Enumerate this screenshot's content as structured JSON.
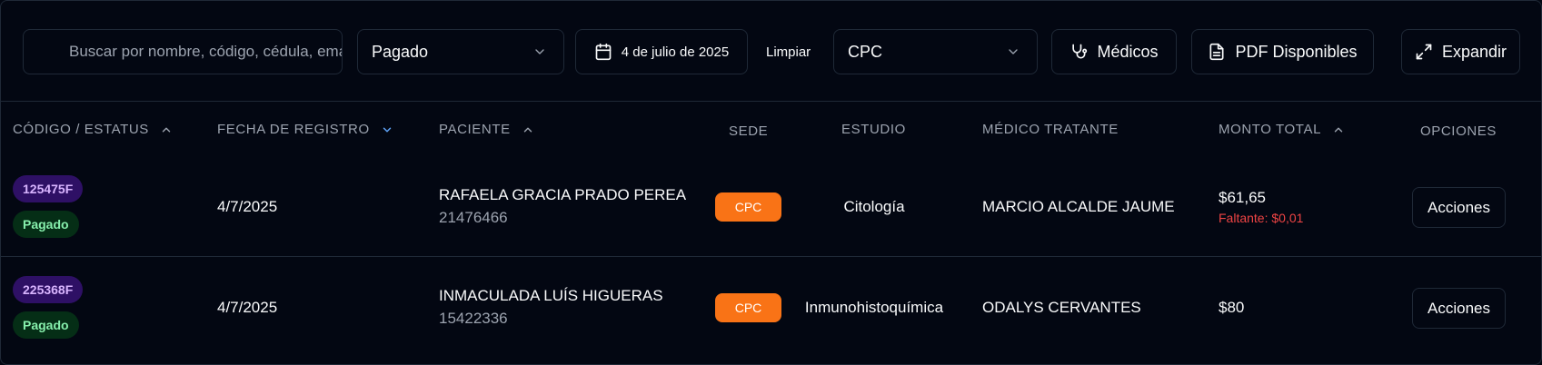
{
  "toolbar": {
    "search_placeholder": "Buscar por nombre, código, cédula, email...",
    "status_filter": "Pagado",
    "date_filter": "4 de julio de 2025",
    "clear_label": "Limpiar",
    "branch_filter": "CPC",
    "doctors_label": "Médicos",
    "pdf_label": "PDF Disponibles",
    "expand_label": "Expandir"
  },
  "table": {
    "headers": {
      "code_status": "CÓDIGO / ESTATUS",
      "registration_date": "FECHA DE REGISTRO",
      "patient": "PACIENTE",
      "branch": "SEDE",
      "study": "ESTUDIO",
      "doctor": "MÉDICO TRATANTE",
      "total": "MONTO TOTAL",
      "options": "OPCIONES"
    },
    "rows": [
      {
        "code": "125475F",
        "status": "Pagado",
        "date": "4/7/2025",
        "patient_name": "RAFAELA GRACIA PRADO PEREA",
        "patient_id": "21476466",
        "branch": "CPC",
        "study": "Citología",
        "doctor": "MARCIO ALCALDE JAUME",
        "total": "$61,65",
        "pending": "Faltante: $0,01",
        "action": "Acciones"
      },
      {
        "code": "225368F",
        "status": "Pagado",
        "date": "4/7/2025",
        "patient_name": "INMACULADA LUÍS HIGUERAS",
        "patient_id": "15422336",
        "branch": "CPC",
        "study": "Inmunohistoquímica",
        "doctor": "ODALYS CERVANTES",
        "total": "$80",
        "pending": "",
        "action": "Acciones"
      }
    ]
  },
  "colors": {
    "background": "#030712",
    "border": "#1f2937",
    "branch_badge": "#f97316",
    "code_badge_bg": "#2e1065",
    "code_badge_text": "#d8b4fe",
    "status_badge_bg": "#052e16",
    "status_badge_text": "#86efac",
    "pending_text": "#ef4444",
    "sort_active": "#60a5fa"
  },
  "icons": {
    "status_chevron": "chevron-down-icon",
    "date": "calendar-icon",
    "branch_chevron": "chevron-down-icon",
    "doctors": "stethoscope-icon",
    "pdf": "file-text-icon",
    "expand": "expand-icon",
    "sort_up": "chevron-up-icon",
    "sort_down": "chevron-down-icon"
  }
}
